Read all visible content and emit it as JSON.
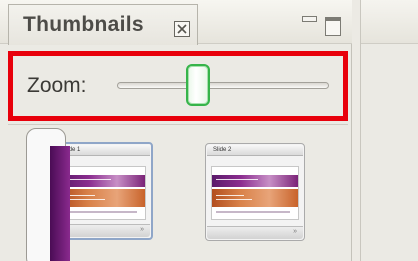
{
  "panel": {
    "title": "Thumbnails",
    "close_icon": "close-x-icon",
    "minimize_icon": "minimize-icon",
    "maximize_icon": "maximize-icon"
  },
  "zoom": {
    "label": "Zoom:",
    "highlight_color": "#e8000b",
    "thumb_color": "#36b44a"
  },
  "thumbnails": [
    {
      "title": "Slide 1",
      "selected": true,
      "footer_icon": "»"
    },
    {
      "title": "Slide 2",
      "selected": false,
      "footer_icon": "»"
    }
  ],
  "colors": {
    "slide_band": "#8b2c8f",
    "slide_orange": "#d9824a"
  }
}
